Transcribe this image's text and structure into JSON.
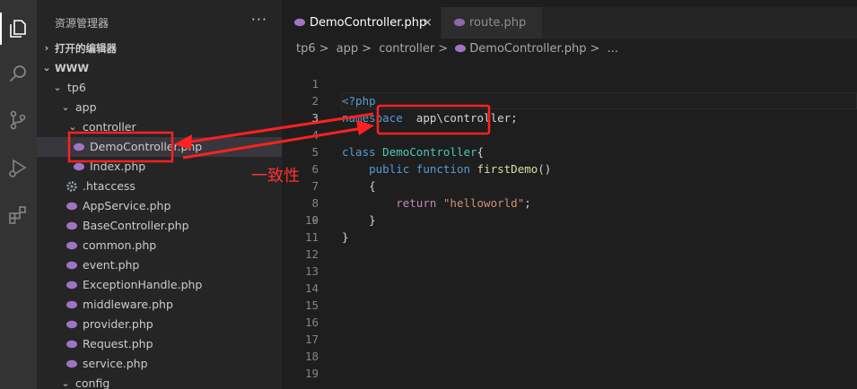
{
  "sidebar": {
    "title": "资源管理器",
    "more": "···",
    "sections": {
      "open_editors": "打开的编辑器",
      "workspace": "WWW"
    },
    "tree": {
      "tp6": "tp6",
      "app": "app",
      "controller": "controller",
      "democontroller": "DemoController.php",
      "index": "Index.php",
      "htaccess": ".htaccess",
      "appservice": "AppService.php",
      "basecontroller": "BaseController.php",
      "common": "common.php",
      "event": "event.php",
      "exceptionhandle": "ExceptionHandle.php",
      "middleware": "middleware.php",
      "provider": "provider.php",
      "request": "Request.php",
      "service": "service.php",
      "config": "config"
    }
  },
  "tabs": [
    {
      "label": "DemoController.php",
      "close": "×"
    },
    {
      "label": "route.php"
    }
  ],
  "breadcrumb": {
    "tp6": "tp6",
    "app": "app",
    "controller": "controller",
    "file": "DemoController.php",
    "sep": ">",
    "ellipsis": "..."
  },
  "code": {
    "line_numbers": [
      "1",
      "2",
      "3",
      "4",
      "5",
      "6",
      "7",
      "8",
      "9",
      "10",
      "11",
      "12",
      "13",
      "14",
      "15",
      "16",
      "17",
      "18",
      "19"
    ],
    "l1": "<?php",
    "l2_kw": "namespace",
    "l2_ns": "app\\controller;",
    "l4_kw": "class",
    "l4_name": "DemoController",
    "l4_brace": "{",
    "l5_kw1": "public",
    "l5_kw2": "function",
    "l5_fn": "firstDemo",
    "l5_paren": "()",
    "l6": "{",
    "l7_kw": "return",
    "l7_str": "\"helloworld\"",
    "l7_semi": ";",
    "l8": "}",
    "l9": "}"
  },
  "annotation": {
    "text": "一致性",
    "color": "#ff2020"
  },
  "colors": {
    "php_icon": "#a074c4",
    "gear_icon": "#9aa5b1"
  }
}
